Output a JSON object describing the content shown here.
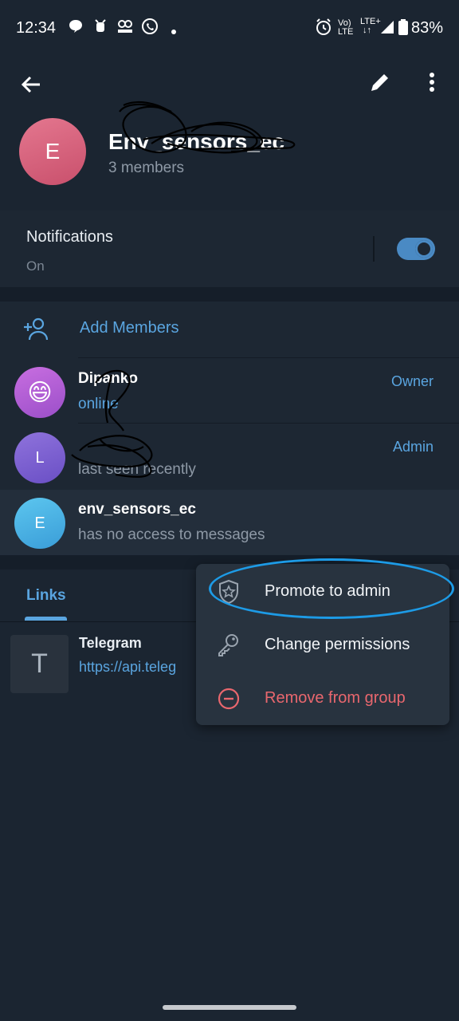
{
  "status_bar": {
    "time": "12:34",
    "battery": "83%",
    "network": "LTE+"
  },
  "header": {
    "group_initial": "E",
    "group_name": "Env_sensors_ec",
    "member_count": "3 members"
  },
  "notifications": {
    "title": "Notifications",
    "state": "On",
    "enabled": true
  },
  "members": {
    "add_label": "Add Members",
    "list": [
      {
        "initial": "😄",
        "name": "Dipanko",
        "status": "online",
        "role": "Owner",
        "avatar_color": "#b45ad6"
      },
      {
        "initial": "L",
        "name": "",
        "status": "last seen recently",
        "role": "Admin",
        "avatar_color": "#7e64d4"
      },
      {
        "initial": "E",
        "name": "env_sensors_ec",
        "status": "has no access to messages",
        "role": "",
        "avatar_color": "#45aee0"
      }
    ]
  },
  "tabs": {
    "links_label": "Links"
  },
  "links": [
    {
      "thumb": "T",
      "title": "Telegram",
      "url": "https://api.teleg"
    }
  ],
  "context_menu": {
    "items": [
      {
        "label": "Promote to admin",
        "icon": "shield-star-icon"
      },
      {
        "label": "Change permissions",
        "icon": "key-icon"
      },
      {
        "label": "Remove from group",
        "icon": "minus-circle-icon"
      }
    ]
  },
  "colors": {
    "accent": "#5aa5e0",
    "danger": "#e9676e",
    "background": "#1b2531",
    "highlight": "#1d9be6"
  }
}
